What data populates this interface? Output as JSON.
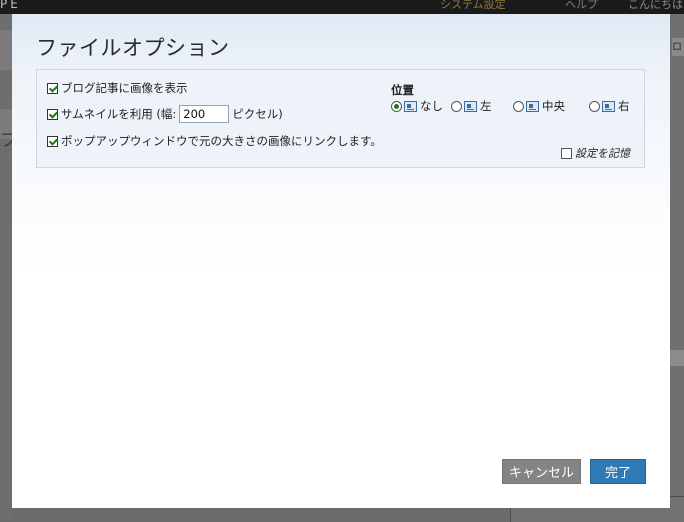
{
  "background": {
    "logo": "PE",
    "nav": [
      "システム設定",
      "ヘルプ",
      "こんにちは"
    ],
    "right_tab": "ログ"
  },
  "dialog": {
    "title": "ファイルオプション",
    "options": {
      "show_image": {
        "label": "ブログ記事に画像を表示",
        "checked": true
      },
      "use_thumbnail": {
        "label_before": "サムネイルを利用 (幅:",
        "width_value": "200",
        "label_after": "ピクセル)",
        "checked": true
      },
      "popup_link": {
        "label": "ポップアップウィンドウで元の大きさの画像にリンクします。",
        "checked": true
      }
    },
    "position": {
      "label": "位置",
      "options": [
        {
          "label": "なし",
          "icon": "align-none-icon",
          "selected": true
        },
        {
          "label": "左",
          "icon": "align-left-icon",
          "selected": false
        },
        {
          "label": "中央",
          "icon": "align-center-icon",
          "selected": false
        },
        {
          "label": "右",
          "icon": "align-right-icon",
          "selected": false
        }
      ]
    },
    "remember": {
      "label": "設定を記憶",
      "checked": false
    },
    "buttons": {
      "cancel": "キャンセル",
      "done": "完了"
    }
  },
  "colors": {
    "primary_button": "#2f7ab4",
    "cancel_button": "#848484",
    "panel_border": "#c9d6e4",
    "check_mark": "#1a7a1a"
  }
}
